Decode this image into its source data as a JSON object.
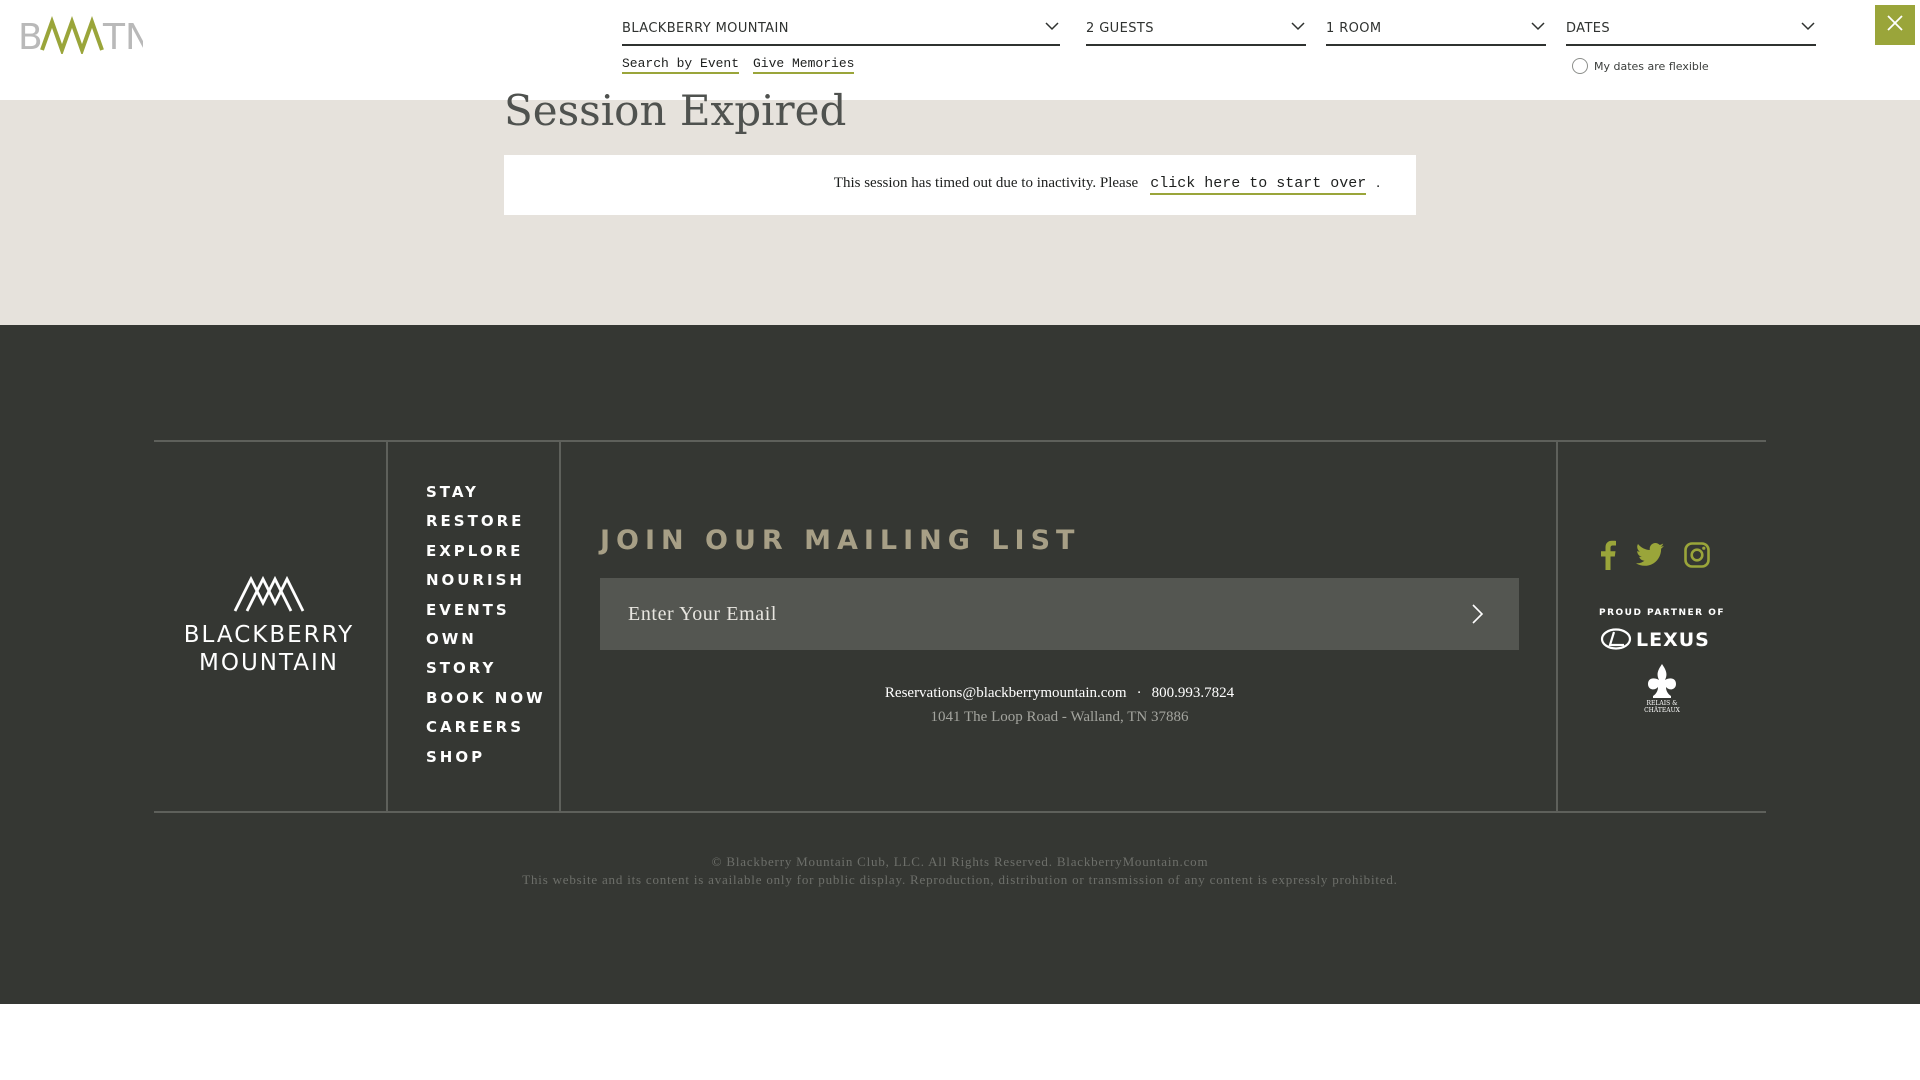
{
  "header": {
    "logo_text": "BMTN",
    "booking": {
      "destination": "BLACKBERRY MOUNTAIN",
      "guests": "2 GUESTS",
      "rooms": "1 ROOM",
      "dates": "DATES"
    },
    "links": {
      "search_by_event": "Search by Event",
      "give_memories": "Give Memories"
    },
    "flexible_dates_label": "My dates are flexible",
    "flexible_dates_checked": false,
    "close_icon": "close-icon"
  },
  "main": {
    "title": "Session Expired",
    "message": "This session has timed out due to inactivity. Please",
    "link_label": "click here to start over",
    "message_end": "."
  },
  "footer": {
    "brand_line1": "BLACKBERRY",
    "brand_line2": "MOUNTAIN",
    "nav": [
      "STAY",
      "RESTORE",
      "EXPLORE",
      "NOURISH",
      "EVENTS",
      "OWN",
      "STORY",
      "BOOK NOW",
      "CAREERS",
      "SHOP"
    ],
    "mailing_heading": "JOIN OUR MAILING LIST",
    "email_placeholder": "Enter Your Email",
    "email": "Reservations@blackberrymountain.com",
    "separator": "·",
    "phone": "800.993.7824",
    "address": "1041 The Loop Road - Walland, TN 37886",
    "social_icons": [
      "facebook-icon",
      "twitter-icon",
      "instagram-icon"
    ],
    "partner_label": "PROUD PARTNER OF",
    "partner_lexus": "LEXUS",
    "partner_relais": "RELAIS & CHATEAUX",
    "copyright": "© Blackberry Mountain Club, LLC. All Rights Reserved. BlackberryMountain.com",
    "disclaimer": "This website and its content is available only for public display. Reproduction, distribution or transmission of any content is expressly prohibited."
  },
  "colors": {
    "accent": "#9aa53a",
    "header_bg": "#ffffff",
    "main_bg": "#e6e2dc",
    "footer_bg": "#353733",
    "mailing_heading": "#a79f86",
    "social_icon": "#9aa53a"
  }
}
